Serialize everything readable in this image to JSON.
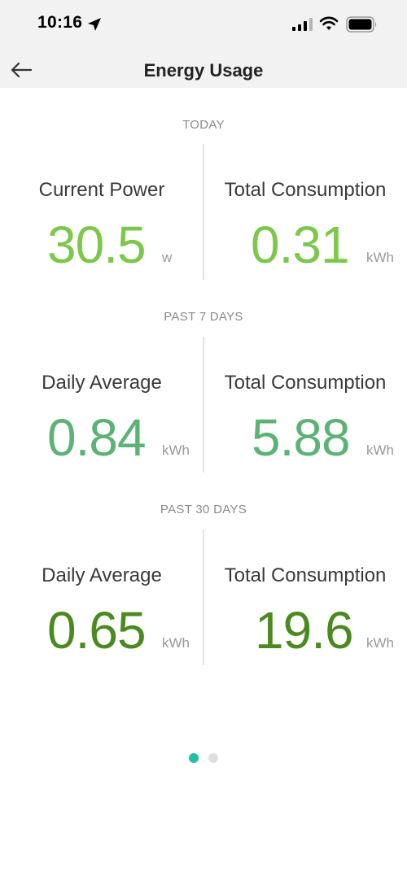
{
  "status_bar": {
    "time": "10:16",
    "icons": [
      "location-arrow-icon",
      "cellular-signal-icon",
      "wifi-icon",
      "battery-icon"
    ]
  },
  "nav": {
    "title": "Energy Usage",
    "back_icon": "arrow-left-icon"
  },
  "colors": {
    "today": "#7cc84a",
    "past7": "#5db276",
    "past30": "#4a8a1e",
    "dot_active": "#1fbfaa",
    "dot_inactive": "#e0e0e0"
  },
  "sections": [
    {
      "label": "TODAY",
      "left": {
        "title": "Current Power",
        "value": "30.5",
        "unit": "w"
      },
      "right": {
        "title": "Total Consumption",
        "value": "0.31",
        "unit": "kWh"
      }
    },
    {
      "label": "PAST 7 DAYS",
      "left": {
        "title": "Daily Average",
        "value": "0.84",
        "unit": "kWh"
      },
      "right": {
        "title": "Total Consumption",
        "value": "5.88",
        "unit": "kWh"
      }
    },
    {
      "label": "PAST 30 DAYS",
      "left": {
        "title": "Daily Average",
        "value": "0.65",
        "unit": "kWh"
      },
      "right": {
        "title": "Total Consumption",
        "value": "19.6",
        "unit": "kWh"
      }
    }
  ],
  "pager": {
    "pages": 2,
    "active": 1
  }
}
